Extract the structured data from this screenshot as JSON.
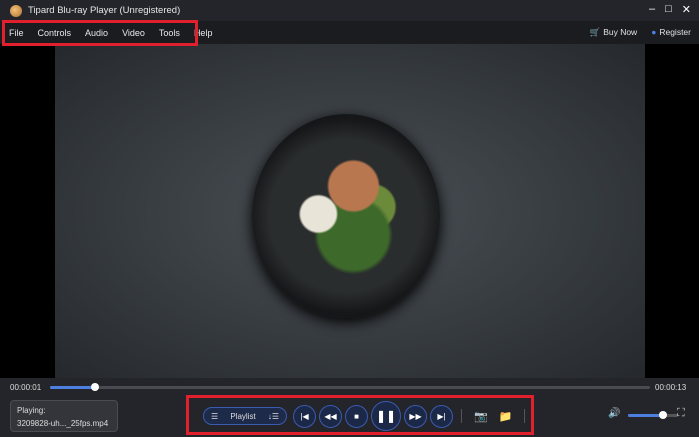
{
  "window": {
    "title": "Tipard Blu-ray Player (Unregistered)",
    "controls": [
      "minimize",
      "maximize",
      "close"
    ]
  },
  "menu": {
    "items": [
      "File",
      "Controls",
      "Audio",
      "Video",
      "Tools",
      "Help"
    ],
    "buy_now": "Buy Now",
    "register": "Register"
  },
  "playback": {
    "current_time": "00:00:01",
    "total_time": "00:00:13",
    "progress_percent": 7.5,
    "playing_label": "Playing:",
    "file_name": "3209828-uh..._25fps.mp4",
    "volume_percent": 70
  },
  "controls": {
    "playlist_label": "Playlist",
    "buttons": [
      "previous",
      "rewind",
      "stop",
      "pause",
      "fast-forward",
      "next",
      "snapshot",
      "open-folder"
    ]
  },
  "colors": {
    "accent": "#4d7fe0",
    "highlight": "#e0202c"
  }
}
